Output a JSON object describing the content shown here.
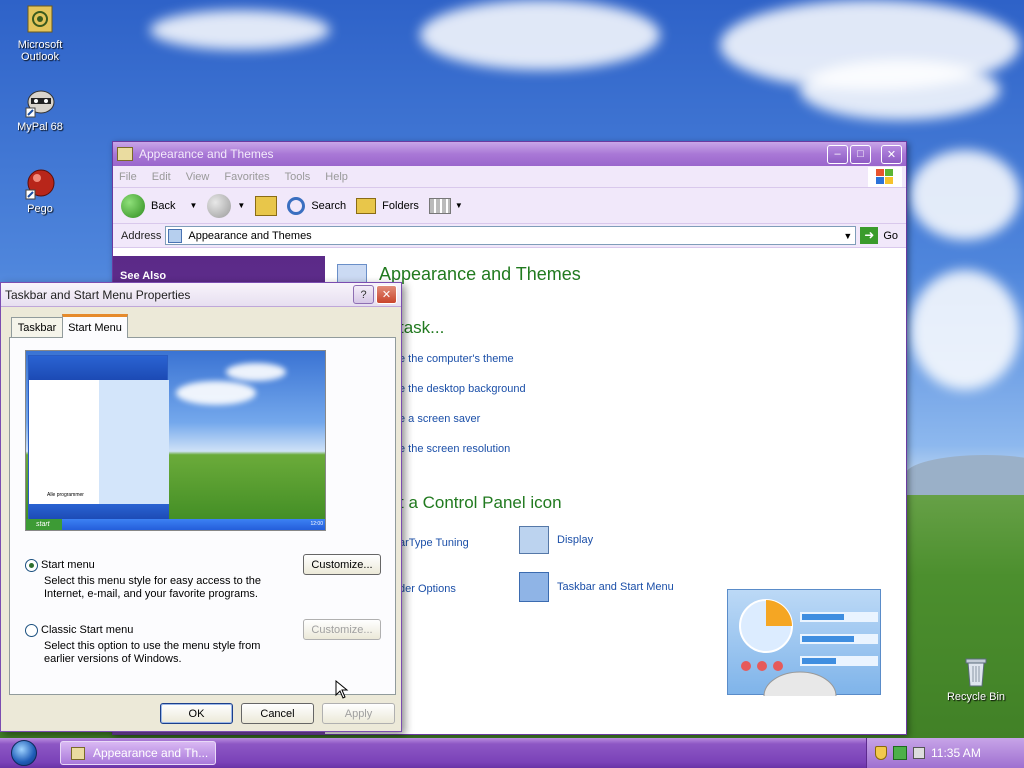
{
  "desktop": {
    "icons": [
      {
        "label_line1": "Microsoft",
        "label_line2": "Outlook"
      },
      {
        "label_line1": "MyPal 68",
        "label_line2": ""
      },
      {
        "label_line1": "Pego",
        "label_line2": ""
      },
      {
        "label_line1": "Recycle Bin",
        "label_line2": ""
      }
    ]
  },
  "explorer": {
    "title": "Appearance and Themes",
    "menu": [
      "File",
      "Edit",
      "View",
      "Favorites",
      "Tools",
      "Help"
    ],
    "toolbar": {
      "back": "Back",
      "search": "Search",
      "folders": "Folders"
    },
    "address_label": "Address",
    "address_value": "Appearance and Themes",
    "go": "Go",
    "see_also": "See Also",
    "heading": "Appearance and Themes",
    "pick_task": "task...",
    "tasks": [
      "e the computer's theme",
      "e the desktop background",
      "e a screen saver",
      "e the screen resolution"
    ],
    "pick_icon": "t a Control Panel icon",
    "icons": [
      {
        "label": "arType Tuning"
      },
      {
        "label": "Display"
      },
      {
        "label": "der Options"
      },
      {
        "label": "Taskbar and Start Menu"
      }
    ]
  },
  "dialog": {
    "title": "Taskbar and Start Menu Properties",
    "help": "?",
    "tabs": [
      "Taskbar",
      "Start Menu"
    ],
    "preview": {
      "start": "start",
      "all_programs": "Alle programmer",
      "clock": "12:00"
    },
    "option1": {
      "label": "Start menu",
      "desc1": "Select this menu style for easy access to the",
      "desc2": "Internet, e-mail, and your favorite programs.",
      "button": "Customize..."
    },
    "option2": {
      "label": "Classic Start menu",
      "desc1": "Select this option to use the menu style from",
      "desc2": "earlier versions of Windows.",
      "button": "Customize..."
    },
    "ok": "OK",
    "cancel": "Cancel",
    "apply": "Apply"
  },
  "taskbar": {
    "task": "Appearance and Th...",
    "clock": "11:35 AM"
  },
  "colors": {
    "link": "#1b4fa8",
    "heading": "#217a1f",
    "taskbar": "#7b42b8"
  }
}
